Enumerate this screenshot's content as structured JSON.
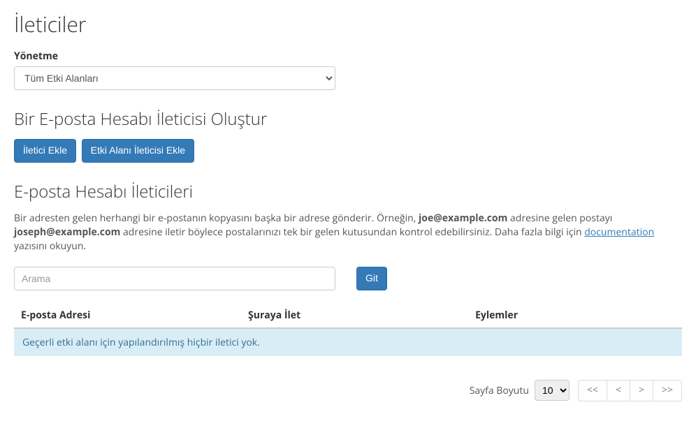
{
  "page_title": "İleticiler",
  "manage": {
    "label": "Yönetme",
    "selected": "Tüm Etki Alanları"
  },
  "create_section": {
    "heading": "Bir E-posta Hesabı İleticisi Oluştur",
    "add_forwarder": "İletici Ekle",
    "add_domain_forwarder": "Etki Alanı İleticisi Ekle"
  },
  "list_section": {
    "heading": "E-posta Hesabı İleticileri",
    "desc_pre": "Bir adresten gelen herhangi bir e-postanın kopyasını başka bir adrese gönderir. Örneğin, ",
    "desc_mid1": " adresine gelen postayı ",
    "desc_mid2": " adresine iletir böylece postalarınızı tek bir gelen kutusundan kontrol edebilirsiniz. Daha fazla bilgi için ",
    "desc_post": " yazısını okuyun.",
    "example1": "joe@example.com",
    "example2": "joseph@example.com",
    "doc_link": "documentation",
    "search_placeholder": "Arama",
    "go_button": "Git",
    "col_email": "E-posta Adresi",
    "col_forward_to": "Şuraya İlet",
    "col_actions": "Eylemler",
    "empty_message": "Geçerli etki alanı için yapılandırılmış hiçbir iletici yok."
  },
  "pager": {
    "label": "Sayfa Boyutu",
    "size": "10",
    "first": "<<",
    "prev": "<",
    "next": ">",
    "last": ">>"
  }
}
